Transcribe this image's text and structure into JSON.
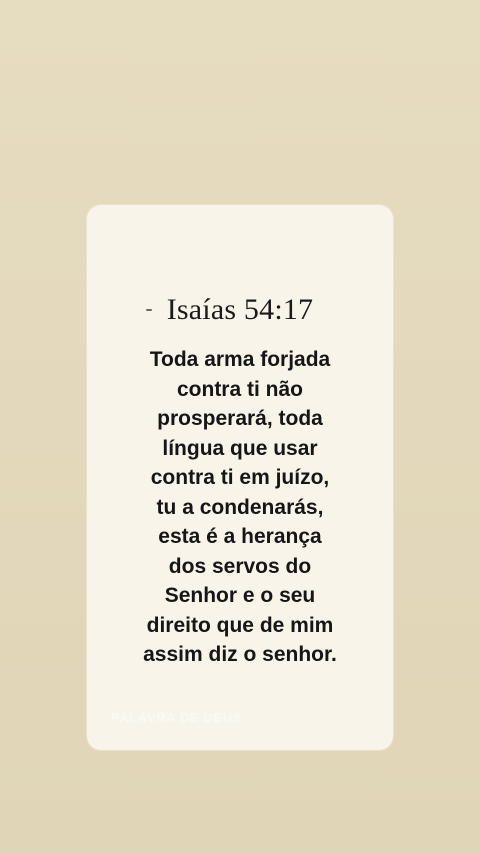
{
  "card": {
    "reference": "Isaías 54:17",
    "verse_lines": [
      "Toda arma forjada",
      "contra ti não",
      "prosperará, toda",
      "língua que usar",
      "contra ti em juízo,",
      "tu a condenarás,",
      "esta é a herança",
      "dos servos do",
      "Senhor e o seu",
      "direito que de mim",
      "assim diz o senhor."
    ],
    "watermark": "PALAVRA DE DEUS"
  },
  "colors": {
    "background": "#e4d9bc",
    "card": "#f8f4ea",
    "text": "#161616"
  }
}
